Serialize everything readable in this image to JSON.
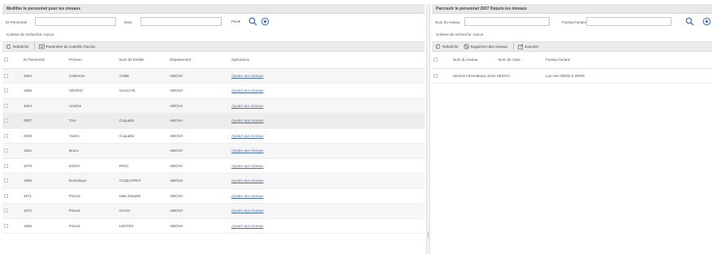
{
  "colors": {
    "accent": "#4a7ac0",
    "title_bg": "#e8e8e8",
    "toolbar_bg": "#ececec",
    "link": "#4a6ea8"
  },
  "left": {
    "title": "Modifier le personnel pour les niveaux",
    "search": {
      "id_label": "ID Personnel",
      "id_value": "",
      "name_label": "Nom",
      "name_value": "",
      "more_label": "Plus",
      "search_icon": "search-icon",
      "clear_icon": "clear-icon"
    },
    "criteria": "Critères de recherche: Aucun",
    "toolbar": {
      "refresh": "Rafraîchir",
      "access_params": "Paramètre de contrôle d'accès"
    },
    "columns": [
      "ID Personnel",
      "Prénom",
      "Nom de famille",
      "Département",
      "Opérations"
    ],
    "rows": [
      {
        "id": "2664",
        "first": "Catherine",
        "last": "AUBE",
        "dept": "ABIOVA",
        "op": "Ajouter aux niveaux"
      },
      {
        "id": "1666",
        "first": "CEDRIC",
        "last": "GALICHE",
        "dept": "ABIOVA",
        "op": "Ajouter aux niveaux"
      },
      {
        "id": "1664",
        "first": "Antoine",
        "last": "",
        "dept": "ABIOVA",
        "op": "Ajouter aux niveaux"
      },
      {
        "id": "2007",
        "first": "Tom",
        "last": "Coquatto",
        "dept": "ABIOVA",
        "op": "Ajouter aux niveaux"
      },
      {
        "id": "2006",
        "first": "Yoann",
        "last": "Coquatto",
        "dept": "ABIOVA",
        "op": "Ajouter aux niveaux"
      },
      {
        "id": "1062",
        "first": "Bruno",
        "last": "",
        "dept": "ABIOVA",
        "op": "Ajouter aux niveaux"
      },
      {
        "id": "1670",
        "first": "KOKO",
        "last": "RIKO",
        "dept": "ABIOVA",
        "op": "Ajouter aux niveaux"
      },
      {
        "id": "1665",
        "first": "Dominique",
        "last": "COQUATRIX",
        "dept": "ABIOVA",
        "op": "Ajouter aux niveaux"
      },
      {
        "id": "1671",
        "first": "Pascal",
        "last": "Mais Daudrie",
        "dept": "ABIOVA",
        "op": "Ajouter aux niveaux"
      },
      {
        "id": "1672",
        "first": "Pascal",
        "last": "CHAN",
        "dept": "ABIOVA",
        "op": "Ajouter aux niveaux"
      },
      {
        "id": "1666",
        "first": "Pascal",
        "last": "LENTES",
        "dept": "ABIOVA",
        "op": "Ajouter aux niveaux"
      }
    ]
  },
  "right": {
    "title": "Parcourir le personnel 2007 Depuis les niveaux",
    "search": {
      "level_label": "Nom du niveau",
      "level_value": "",
      "tz_label": "Fuseau horaire",
      "tz_value": "",
      "search_icon": "search-icon",
      "clear_icon": "clear-icon"
    },
    "criteria": "Critères de recherche: Aucun",
    "toolbar": {
      "refresh": "Rafraîchir",
      "remove": "Supprimer des niveaux",
      "export": "Exporter"
    },
    "columns": [
      "Nom du niveau",
      "Nom de zone",
      "Fuseau horaire"
    ],
    "rows": [
      {
        "level": "Service informatique",
        "zone": "Zone ABIOVA",
        "tz": "Lun-Ven 08h00 à 20h00"
      }
    ]
  }
}
